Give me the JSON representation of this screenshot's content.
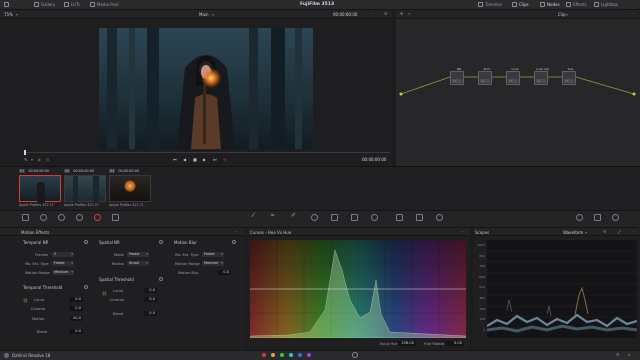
{
  "topbar": {
    "left_items": [
      "Gallery",
      "LUTs",
      "Media Pool"
    ],
    "title": "FujiFilm 3513",
    "right_items": [
      "Timeline",
      "Clips",
      "Nodes",
      "Effects",
      "Lightbox"
    ]
  },
  "viewer": {
    "zoom": "75%",
    "label": "Main",
    "timecode_top": "00:00:00:00",
    "timecode_bottom": "00:00:00:00"
  },
  "nodes_bar": {
    "clip_label": "Clip"
  },
  "nodes": [
    {
      "label": "NR",
      "num": "01"
    },
    {
      "label": "Prim",
      "num": "02"
    },
    {
      "label": "Look",
      "num": "03"
    },
    {
      "label": "Look Adj.",
      "num": "04"
    },
    {
      "label": "Sub.",
      "num": "05"
    }
  ],
  "thumbnails": [
    {
      "index": "01",
      "tc": "00:00:00:00",
      "selected": true
    },
    {
      "index": "02",
      "tc": "00:00:00:00",
      "selected": false
    },
    {
      "index": "03",
      "tc": "00:00:00:00",
      "selected": false
    }
  ],
  "thumbnail_captions": [
    "Apple ProRes 422 LT",
    "Apple ProRes 422 LT",
    "Apple ProRes 422 LT"
  ],
  "motion_effects": {
    "title": "Motion Effects",
    "temporal_nr": {
      "header": "Temporal NR",
      "frames_label": "Frames",
      "frames_value": "2",
      "mo_est_type_label": "Mo. Est. Type",
      "mo_est_type_value": "Faster",
      "motion_range_label": "Motion Range",
      "motion_range_value": "Medium"
    },
    "spatial_nr": {
      "header": "Spatial NR",
      "mode_label": "Mode",
      "mode_value": "Faster",
      "radius_label": "Radius",
      "radius_value": "Small"
    },
    "motion_blur": {
      "header": "Motion Blur",
      "mo_est_type_label": "Mo. Est. Type",
      "mo_est_type_value": "Faster",
      "motion_range_label": "Motion Range",
      "motion_range_value": "Medium",
      "motion_blur_label": "Motion Blur",
      "motion_blur_value": "0.0"
    },
    "temporal_threshold": {
      "header": "Temporal Threshold",
      "luma_label": "Luma",
      "luma_value": "0.0",
      "chroma_label": "Chroma",
      "chroma_value": "0.0",
      "motion_label": "Motion",
      "motion_value": "50.0",
      "blend_label": "Blend",
      "blend_value": "0.0"
    },
    "spatial_threshold": {
      "header": "Spatial Threshold",
      "luma_label": "Luma",
      "luma_value": "0.0",
      "chroma_label": "Chroma",
      "chroma_value": "0.0",
      "blend_label": "Blend",
      "blend_value": "0.0"
    }
  },
  "curves": {
    "title": "Curves - Hue Vs Hue",
    "input_hue_label": "Input Hue",
    "input_hue_value": "256.00",
    "hue_rotate_label": "Hue Rotate",
    "hue_rotate_value": "0.00",
    "dot_colors": [
      "#e03a3a",
      "#e0a23a",
      "#3ac24a",
      "#3ac2c2",
      "#3a6ae0",
      "#b03ae0"
    ]
  },
  "scopes": {
    "title": "Scopes",
    "mode": "Waveform",
    "ticks": [
      "1023",
      "896",
      "768",
      "640",
      "512",
      "384",
      "256",
      "128",
      "0"
    ]
  },
  "bottombar": {
    "app": "DaVinci Resolve 18"
  },
  "colors": {
    "accent_red": "#d63b3b",
    "panel": "#1f1f21"
  }
}
